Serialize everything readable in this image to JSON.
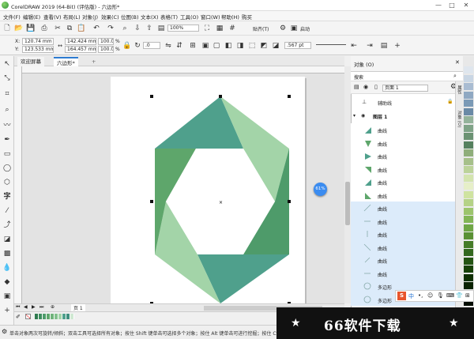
{
  "window": {
    "title": "CorelDRAW 2019 (64-Bit) (评估版) - 六边形*",
    "minimize": "—",
    "maximize": "□",
    "close": "✕"
  },
  "menu": [
    "文件(F)",
    "编辑(E)",
    "查看(V)",
    "布局(L)",
    "对象(J)",
    "效果(C)",
    "位图(B)",
    "文本(X)",
    "表格(T)",
    "工具(O)",
    "窗口(W)",
    "帮助(H)",
    "购买"
  ],
  "toolbar": {
    "zoom": "100%",
    "snap_label": "贴齐(T)",
    "launch_label": "启动"
  },
  "props": {
    "x_label": "X:",
    "x_value": "120.74 mm",
    "y_label": "Y:",
    "y_value": "123.533 mm",
    "w_value": "142.424 mm",
    "h_value": "164.457 mm",
    "scale_w": "100.0",
    "scale_h": "100.0",
    "pct": "%",
    "angle": ".0",
    "outline_width": ".567 pt"
  },
  "tabs": [
    {
      "label": "欢迎屏幕"
    },
    {
      "label": "六边形*"
    }
  ],
  "float_button": "61%",
  "page_nav": {
    "label": "页 1"
  },
  "status": {
    "text": "单击对象两次可旋转/倾斜；双击工具可选择所有对象；按住 Shift 键单击可选择多个对象；按住 Alt 键单击可进行挖掘；按住 Ctrl 并单击可在组中选"
  },
  "panel": {
    "title": "对象 (O)",
    "search_label": "搜索",
    "page_select": "页面 1",
    "guides": "辅助线",
    "layer": "图层 1",
    "objects": [
      {
        "name": "曲线",
        "thumb": "tri-a",
        "selected": false
      },
      {
        "name": "曲线",
        "thumb": "tri-b",
        "selected": false
      },
      {
        "name": "曲线",
        "thumb": "tri-c",
        "selected": false
      },
      {
        "name": "曲线",
        "thumb": "tri-d",
        "selected": false
      },
      {
        "name": "曲线",
        "thumb": "tri-e",
        "selected": false
      },
      {
        "name": "曲线",
        "thumb": "tri-f",
        "selected": false
      },
      {
        "name": "曲线",
        "thumb": "line-a",
        "selected": true
      },
      {
        "name": "曲线",
        "thumb": "line-b",
        "selected": true
      },
      {
        "name": "曲线",
        "thumb": "line-c",
        "selected": true
      },
      {
        "name": "曲线",
        "thumb": "line-d",
        "selected": true
      },
      {
        "name": "曲线",
        "thumb": "line-e",
        "selected": true
      },
      {
        "name": "曲线",
        "thumb": "line-f",
        "selected": true
      },
      {
        "name": "多边形",
        "thumb": "hex",
        "selected": true
      },
      {
        "name": "多边形",
        "thumb": "hex",
        "selected": true
      }
    ]
  },
  "side_tabs": [
    "属性",
    "对象 (O)"
  ],
  "hexagon_colors": {
    "dark_teal": "#4fa08c",
    "mid_green": "#5ea66b",
    "light_green": "#a3d4a8",
    "deep_green": "#4e9b6a"
  },
  "watermark": {
    "text": "66软件下载",
    "star": "★"
  },
  "ime": "S 中"
}
